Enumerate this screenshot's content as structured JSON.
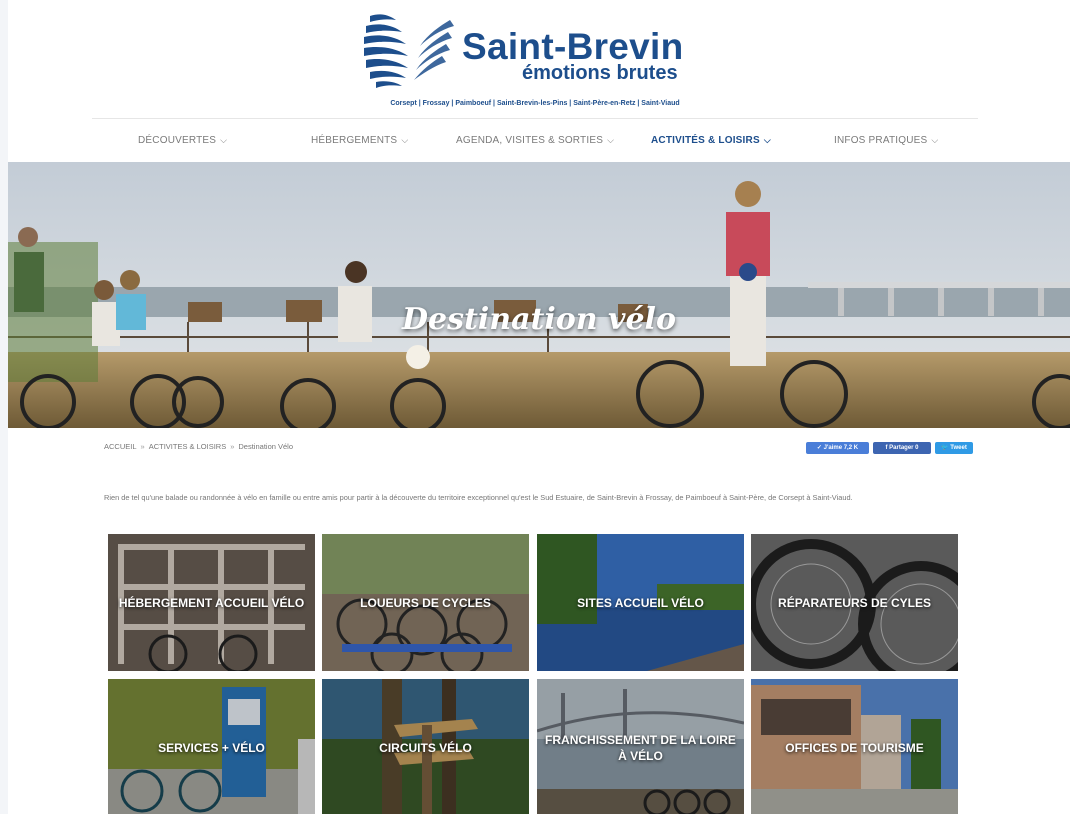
{
  "brand": {
    "name": "Saint-Brevin",
    "tagline": "émotions brutes",
    "communes": "Corsept | Frossay | Paimboeuf | Saint-Brevin-les-Pins | Saint-Père-en-Retz | Saint-Viaud"
  },
  "nav": {
    "items": [
      {
        "label": "DÉCOUVERTES"
      },
      {
        "label": "HÉBERGEMENTS"
      },
      {
        "label": "AGENDA, VISITES & SORTIES"
      },
      {
        "label": "ACTIVITÉS & LOISIRS"
      },
      {
        "label": "INFOS PRATIQUES"
      }
    ],
    "active_index": 3,
    "chevron": "chevron-down-icon"
  },
  "hero": {
    "title": "Destination vélo"
  },
  "breadcrumb": {
    "home": "ACCUEIL",
    "section": "ACTIVITES & LOISIRS",
    "current": "Destination Vélo",
    "separator": "»"
  },
  "share": {
    "like": "✓ J'aime 7,2 K",
    "facebook": "f Partager 0",
    "tweet": "🐦 Tweet"
  },
  "intro": "Rien de tel qu'une balade ou randonnée à vélo en famille ou entre amis pour partir à la découverte du territoire exceptionnel qu'est le Sud Estuaire, de Saint-Brevin à Frossay, de Paimboeuf à Saint-Père, de Corsept à Saint-Viaud.",
  "tiles": [
    {
      "label": "HÉBERGEMENT ACCUEIL VÉLO"
    },
    {
      "label": "LOUEURS DE CYCLES"
    },
    {
      "label": "SITES ACCUEIL VÉLO"
    },
    {
      "label": "RÉPARATEURS DE CYLES"
    },
    {
      "label": "SERVICES + VÉLO"
    },
    {
      "label": "CIRCUITS VÉLO"
    },
    {
      "label": "FRANCHISSEMENT DE LA LOIRE À VÉLO"
    },
    {
      "label": "OFFICES DE TOURISME"
    }
  ],
  "colors": {
    "brand_blue": "#1d4e8c",
    "nav_grey": "#7a7a7a",
    "share_like": "#4a7ed8",
    "share_facebook": "#3d65b1",
    "share_twitter": "#2f9ae5"
  }
}
